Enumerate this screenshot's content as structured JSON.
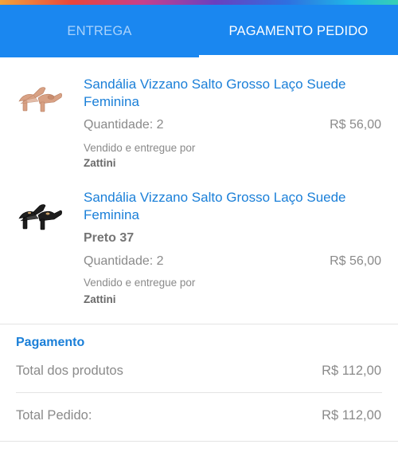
{
  "tabs": [
    {
      "label": "ENTREGA"
    },
    {
      "label": "PAGAMENTO PEDIDO"
    }
  ],
  "items": [
    {
      "title": "Sandália Vizzano Salto Grosso Laço Suede Feminina",
      "variant": "",
      "quantity": "Quantidade: 2",
      "price": "R$ 56,00",
      "sold_by": "Vendido e entregue por",
      "seller": "Zattini",
      "color": "#d8a184"
    },
    {
      "title": "Sandália Vizzano Salto Grosso Laço Suede Feminina",
      "variant": "Preto 37",
      "quantity": "Quantidade: 2",
      "price": "R$ 56,00",
      "sold_by": "Vendido e entregue por",
      "seller": "Zattini",
      "color": "#1e1e1e"
    }
  ],
  "payment": {
    "title": "Pagamento",
    "subtotal_label": "Total dos produtos",
    "subtotal_value": "R$ 112,00",
    "total_label": "Total Pedido:",
    "total_value": "R$ 112,00"
  },
  "colors": {
    "primary": "#1a87f0",
    "link": "#1a7fd8"
  }
}
